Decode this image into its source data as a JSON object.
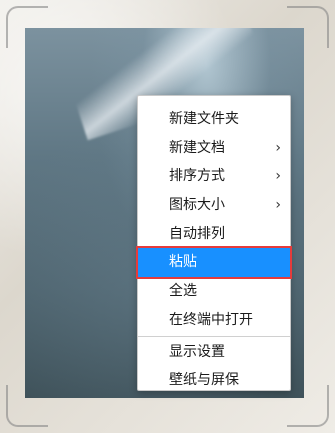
{
  "colors": {
    "selection_bg": "#1890ff",
    "highlight_outline": "#e63b3b",
    "menu_bg": "#ffffff",
    "menu_text": "#1a1a1a"
  },
  "context_menu": {
    "items": [
      {
        "label": "新建文件夹",
        "submenu": false
      },
      {
        "label": "新建文档",
        "submenu": true,
        "icon": "chevron-right-icon"
      },
      {
        "label": "排序方式",
        "submenu": true,
        "icon": "chevron-right-icon"
      },
      {
        "label": "图标大小",
        "submenu": true,
        "icon": "chevron-right-icon"
      },
      {
        "label": "自动排列",
        "submenu": false
      },
      {
        "label": "粘贴",
        "submenu": false,
        "selected": true
      },
      {
        "label": "全选",
        "submenu": false
      },
      {
        "label": "在终端中打开",
        "submenu": false
      },
      {
        "label": "显示设置",
        "submenu": false
      },
      {
        "label": "壁纸与屏保",
        "submenu": false
      }
    ],
    "chevron_glyph": "›"
  }
}
